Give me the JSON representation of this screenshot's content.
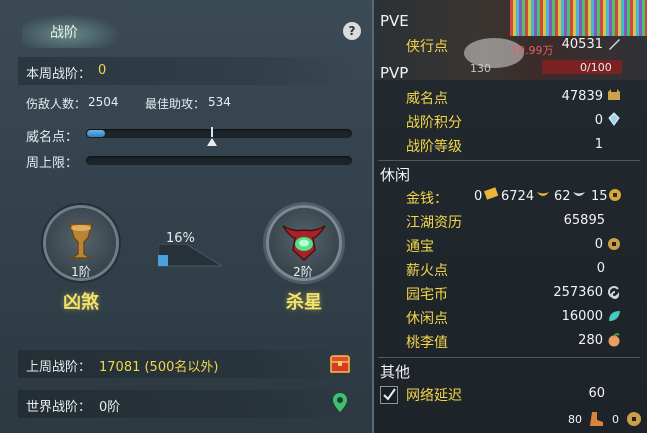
{
  "left": {
    "tab_label": "战阶",
    "help_glyph": "?",
    "weekly_rank_label": "本周战阶：",
    "weekly_rank_value": "0",
    "kills_label": "伤敌人数：",
    "kills_value": "2504",
    "assist_label": "最佳助攻：",
    "assist_value": "534",
    "prestige_label": "威名点：",
    "prestige_progress": 0.07,
    "weekly_cap_label": "周上限：",
    "weekly_cap_progress": 0.0,
    "current_rank_level": "1阶",
    "current_rank_name": "凶煞",
    "next_rank_level": "2阶",
    "next_rank_name": "杀星",
    "rank_progress_text": "16%",
    "rank_progress": 0.16,
    "last_week_label": "上周战阶：",
    "last_week_value": "17081 (500名以外)",
    "world_rank_label": "世界战阶：",
    "world_rank_value": "0阶"
  },
  "right": {
    "top_numbers": [
      "19.99万",
      "130",
      "0/100"
    ],
    "pve_title": "PVE",
    "pve_rows": [
      {
        "label": "侠行点",
        "value": "40531",
        "icon": "sword-icon"
      }
    ],
    "pvp_title": "PVP",
    "pvp_rows": [
      {
        "label": "威名点",
        "value": "47839",
        "icon": "banner-icon"
      },
      {
        "label": "战阶积分",
        "value": "0",
        "icon": "crystal-icon"
      },
      {
        "label": "战阶等级",
        "value": "1",
        "icon": ""
      }
    ],
    "leisure_title": "休闲",
    "money": {
      "label": "金钱：",
      "v1": "0",
      "v2": "6724",
      "v3": "62",
      "v4": "15"
    },
    "leisure_rows": [
      {
        "label": "江湖资历",
        "value": "65895",
        "icon": ""
      },
      {
        "label": "通宝",
        "value": "0",
        "icon": "coin-icon"
      },
      {
        "label": "薪火点",
        "value": "0",
        "icon": ""
      },
      {
        "label": "园宅币",
        "value": "257360",
        "icon": "swirl-icon"
      },
      {
        "label": "休闲点",
        "value": "16000",
        "icon": "leaf-icon"
      },
      {
        "label": "桃李值",
        "value": "280",
        "icon": "peach-icon"
      }
    ],
    "other_title": "其他",
    "latency_label": "网络延迟",
    "latency_value": "60",
    "bottom_value_1": "80",
    "bottom_value_2": "0"
  },
  "colors": {
    "accent_yellow": "#f1d64a",
    "bar_blue": "#3f93d6",
    "panel": "#33424c"
  }
}
